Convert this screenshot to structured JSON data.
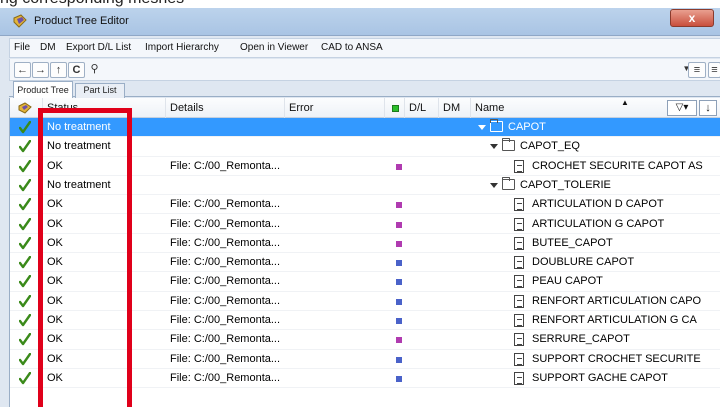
{
  "cropped_caption": "ng corresponding meshes",
  "window": {
    "title": "Product Tree Editor",
    "close_glyph": "x"
  },
  "menu": [
    "File",
    "DM",
    "Export D/L List",
    "Import Hierarchy",
    "Open in Viewer",
    "CAD to ANSA"
  ],
  "toolbar": {
    "buttons": [
      "back-icon",
      "forward-icon",
      "up-icon",
      "refresh-icon",
      "search-icon"
    ],
    "right_buttons": [
      "columns-dropdown-icon",
      "list-view-icon"
    ]
  },
  "tabs": [
    "Product Tree",
    "Part List"
  ],
  "columns": {
    "status": "Status",
    "details": "Details",
    "error": "Error",
    "dl": "D/L",
    "dm": "DM",
    "name": "Name"
  },
  "colors": {
    "selection": "#3399ff",
    "check": "#3a8a1a",
    "magenta_mark": "#b03bb0",
    "blue_mark": "#4a62c9",
    "header_green": "#2bbf2b",
    "highlight_box": "#e0001a"
  },
  "rows": [
    {
      "status": "No treatment",
      "details": "",
      "mark": "",
      "level": 0,
      "kind": "folder",
      "expanded": true,
      "name": "CAPOT",
      "selected": true
    },
    {
      "status": "No treatment",
      "details": "",
      "mark": "",
      "level": 1,
      "kind": "folder",
      "expanded": true,
      "name": "CAPOT_EQ",
      "selected": false
    },
    {
      "status": "OK",
      "details": "File: C:/00_Remonta...",
      "mark": "magenta",
      "level": 2,
      "kind": "doc",
      "expanded": false,
      "name": "CROCHET SECURITE CAPOT AS",
      "selected": false
    },
    {
      "status": "No treatment",
      "details": "",
      "mark": "",
      "level": 1,
      "kind": "folder",
      "expanded": true,
      "name": "CAPOT_TOLERIE",
      "selected": false
    },
    {
      "status": "OK",
      "details": "File: C:/00_Remonta...",
      "mark": "magenta",
      "level": 2,
      "kind": "doc",
      "expanded": false,
      "name": "ARTICULATION D CAPOT",
      "selected": false
    },
    {
      "status": "OK",
      "details": "File: C:/00_Remonta...",
      "mark": "magenta",
      "level": 2,
      "kind": "doc",
      "expanded": false,
      "name": "ARTICULATION G CAPOT",
      "selected": false
    },
    {
      "status": "OK",
      "details": "File: C:/00_Remonta...",
      "mark": "magenta",
      "level": 2,
      "kind": "doc",
      "expanded": false,
      "name": "BUTEE_CAPOT",
      "selected": false
    },
    {
      "status": "OK",
      "details": "File: C:/00_Remonta...",
      "mark": "blue",
      "level": 2,
      "kind": "doc",
      "expanded": false,
      "name": "DOUBLURE CAPOT",
      "selected": false
    },
    {
      "status": "OK",
      "details": "File: C:/00_Remonta...",
      "mark": "blue",
      "level": 2,
      "kind": "doc",
      "expanded": false,
      "name": "PEAU CAPOT",
      "selected": false
    },
    {
      "status": "OK",
      "details": "File: C:/00_Remonta...",
      "mark": "blue",
      "level": 2,
      "kind": "doc",
      "expanded": false,
      "name": "RENFORT ARTICULATION CAPO",
      "selected": false
    },
    {
      "status": "OK",
      "details": "File: C:/00_Remonta...",
      "mark": "blue",
      "level": 2,
      "kind": "doc",
      "expanded": false,
      "name": "RENFORT ARTICULATION G CA",
      "selected": false
    },
    {
      "status": "OK",
      "details": "File: C:/00_Remonta...",
      "mark": "magenta",
      "level": 2,
      "kind": "doc",
      "expanded": false,
      "name": "SERRURE_CAPOT",
      "selected": false
    },
    {
      "status": "OK",
      "details": "File: C:/00_Remonta...",
      "mark": "blue",
      "level": 2,
      "kind": "doc",
      "expanded": false,
      "name": "SUPPORT CROCHET SECURITE",
      "selected": false
    },
    {
      "status": "OK",
      "details": "File: C:/00_Remonta...",
      "mark": "blue",
      "level": 2,
      "kind": "doc",
      "expanded": false,
      "name": "SUPPORT GACHE CAPOT",
      "selected": false
    }
  ]
}
